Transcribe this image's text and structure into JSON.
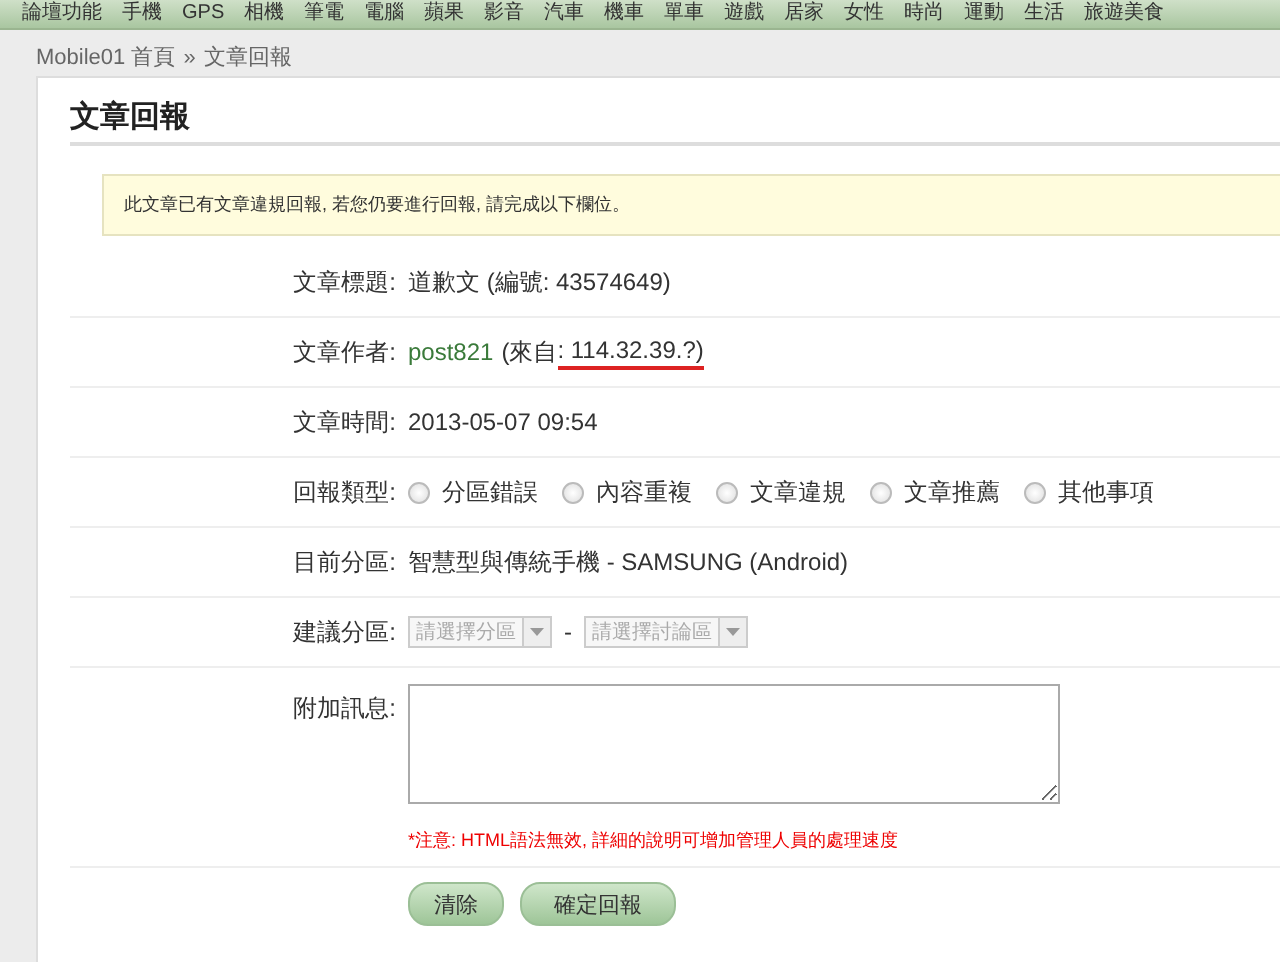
{
  "nav": [
    "論壇功能",
    "手機",
    "GPS",
    "相機",
    "筆電",
    "電腦",
    "蘋果",
    "影音",
    "汽車",
    "機車",
    "單車",
    "遊戲",
    "居家",
    "女性",
    "時尚",
    "運動",
    "生活",
    "旅遊美食"
  ],
  "breadcrumb": {
    "home": "Mobile01 首頁",
    "separator": "»",
    "current": "文章回報"
  },
  "page_title": "文章回報",
  "notice": "此文章已有文章違規回報, 若您仍要進行回報, 請完成以下欄位。",
  "form": {
    "title_row": {
      "label": "文章標題:",
      "value": "道歉文 (編號: 43574649)"
    },
    "author_row": {
      "label": "文章作者:",
      "author": "post821",
      "from_prefix": "(來自",
      "ip": ": 114.32.39.?)"
    },
    "time_row": {
      "label": "文章時間:",
      "value": "2013-05-07 09:54"
    },
    "type_row": {
      "label": "回報類型:",
      "options": [
        {
          "label": "分區錯誤",
          "selected": false
        },
        {
          "label": "內容重複",
          "selected": false
        },
        {
          "label": "文章違規",
          "selected": false
        },
        {
          "label": "文章推薦",
          "selected": false
        },
        {
          "label": "其他事項",
          "selected": false
        }
      ]
    },
    "section_row": {
      "label": "目前分區:",
      "value": "智慧型與傳統手機 - SAMSUNG (Android)"
    },
    "suggest_row": {
      "label": "建議分區:",
      "selects": [
        {
          "placeholder": "請選擇分區",
          "disabled": true
        },
        {
          "placeholder": "請選擇討論區",
          "disabled": true
        }
      ],
      "separator": "-"
    },
    "message_row": {
      "label": "附加訊息:",
      "note": "*注意: HTML語法無效, 詳細的說明可增加管理人員的處理速度"
    },
    "buttons": [
      "清除",
      "確定回報"
    ]
  }
}
